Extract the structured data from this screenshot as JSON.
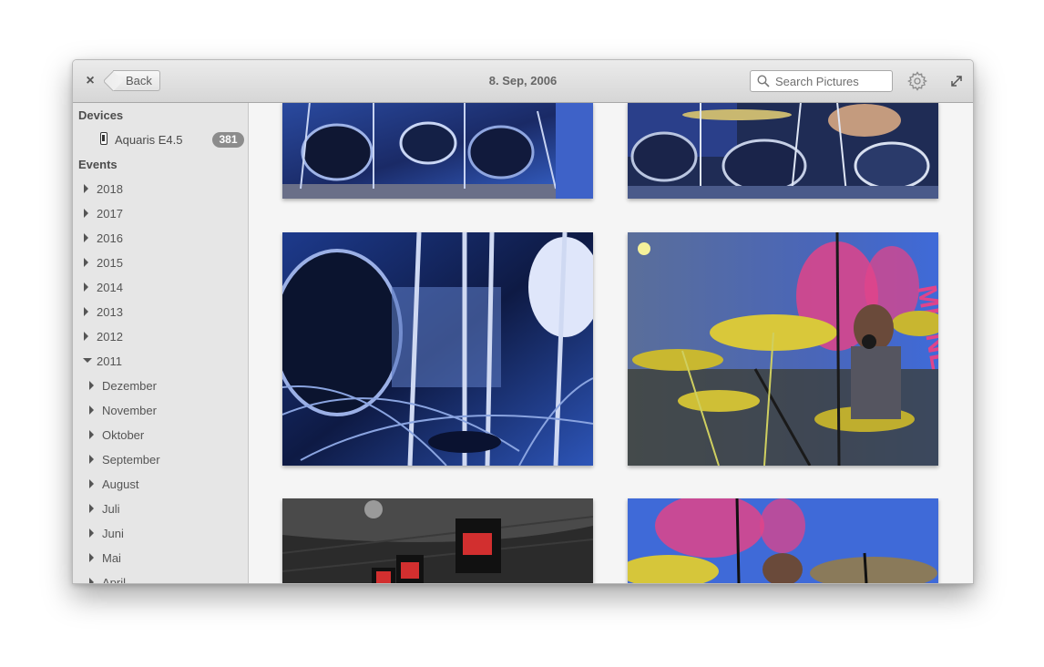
{
  "window": {
    "title": "8. Sep, 2006",
    "back_label": "Back",
    "search_placeholder": "Search Pictures"
  },
  "sidebar": {
    "devices_heading": "Devices",
    "device": {
      "label": "Aquaris E4.5",
      "count": "381"
    },
    "events_heading": "Events",
    "years": [
      "2018",
      "2017",
      "2016",
      "2015",
      "2014",
      "2013",
      "2012"
    ],
    "expanded_year": "2011",
    "months": [
      "Dezember",
      "November",
      "Oktober",
      "September",
      "August",
      "Juli",
      "Juni",
      "Mai",
      "April"
    ]
  },
  "photos": [
    {
      "name": "drum-kit-blue-1"
    },
    {
      "name": "drum-kit-blue-2"
    },
    {
      "name": "drum-stands-closeup"
    },
    {
      "name": "drummer-with-cymbals"
    },
    {
      "name": "stage-meinl-banners"
    },
    {
      "name": "drummer-behind-cymbals"
    }
  ],
  "photo_text": {
    "banner": "MEINL"
  },
  "icons": [
    "close-icon",
    "back-arrow-icon",
    "search-icon",
    "gear-icon",
    "fullscreen-icon",
    "phone-icon"
  ]
}
